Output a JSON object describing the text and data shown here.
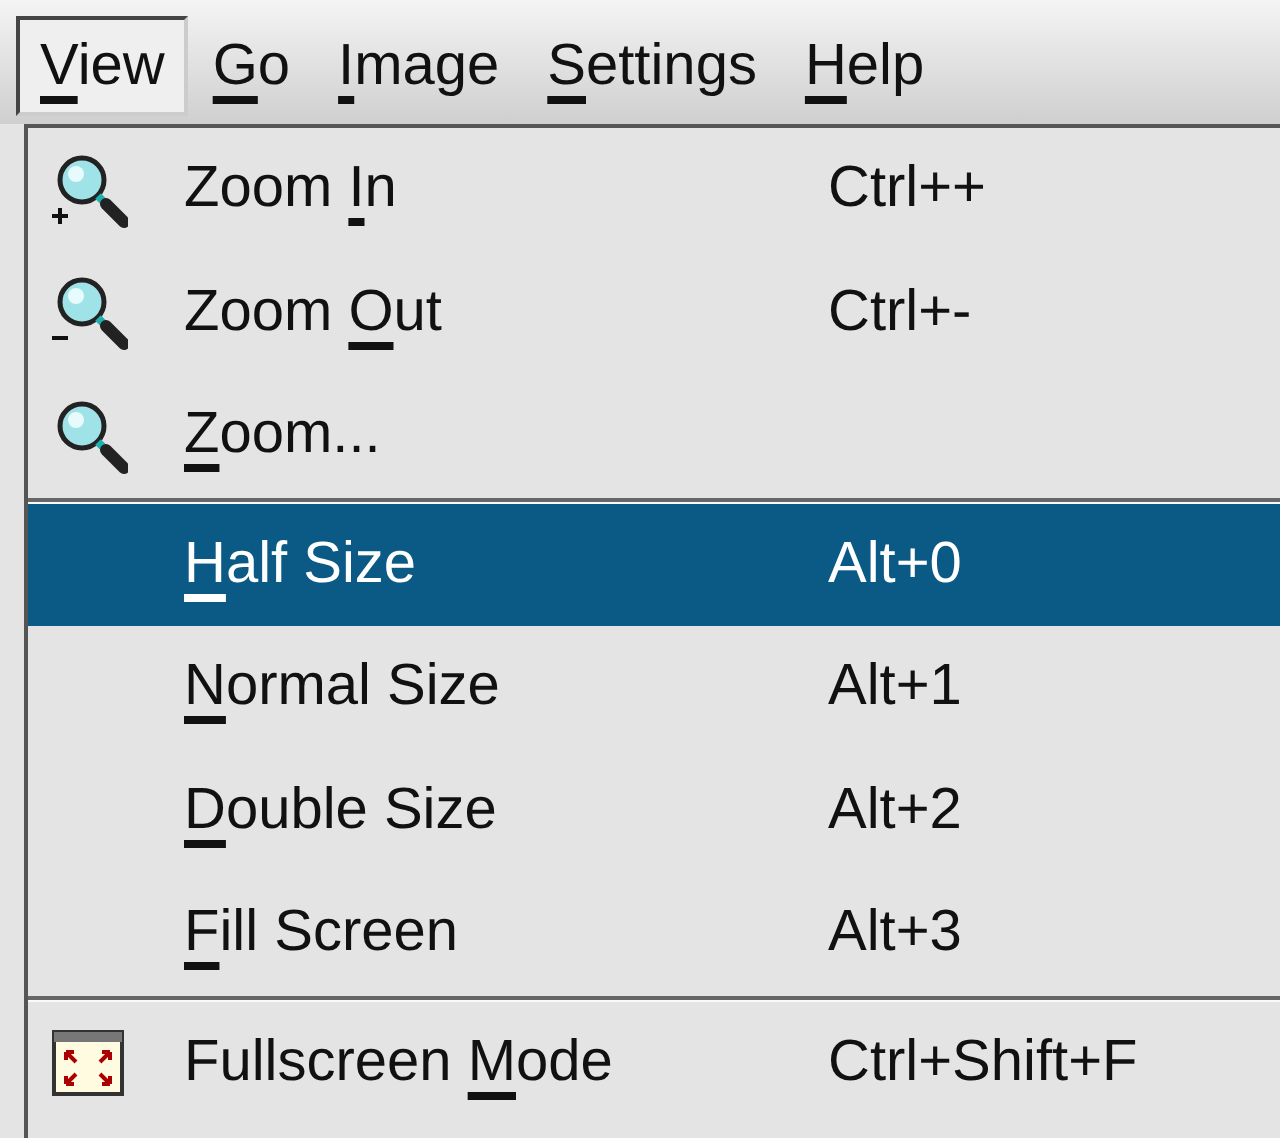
{
  "menubar": [
    {
      "label": [
        {
          "text": "V",
          "underlined": true
        },
        {
          "text": "iew",
          "underlined": false
        }
      ],
      "selected": true
    },
    {
      "label": [
        {
          "text": "G",
          "underlined": true
        },
        {
          "text": "o",
          "underlined": false
        }
      ],
      "selected": false
    },
    {
      "label": [
        {
          "text": "I",
          "underlined": true
        },
        {
          "text": "mage",
          "underlined": false
        }
      ],
      "selected": false
    },
    {
      "label": [
        {
          "text": "S",
          "underlined": true
        },
        {
          "text": "ettings",
          "underlined": false
        }
      ],
      "selected": false
    },
    {
      "label": [
        {
          "text": "H",
          "underlined": true
        },
        {
          "text": "elp",
          "underlined": false
        }
      ],
      "selected": false
    }
  ],
  "menu": [
    {
      "kind": "zoomin",
      "label": [
        {
          "text": "Zoom ",
          "underlined": false
        },
        {
          "text": "I",
          "underlined": true
        },
        {
          "text": "n",
          "underlined": false
        }
      ],
      "shortcut": "Ctrl++",
      "selected": false
    },
    {
      "kind": "zoomout",
      "label": [
        {
          "text": "Zoom ",
          "underlined": false
        },
        {
          "text": "O",
          "underlined": true
        },
        {
          "text": "ut",
          "underlined": false
        }
      ],
      "shortcut": "Ctrl+-",
      "selected": false
    },
    {
      "kind": "zoom",
      "label": [
        {
          "text": "Z",
          "underlined": true
        },
        {
          "text": "oom...",
          "underlined": false
        }
      ],
      "selected": false
    },
    {
      "kind": "separator"
    },
    {
      "kind": "plain",
      "label": [
        {
          "text": "H",
          "underlined": true
        },
        {
          "text": "alf Size",
          "underlined": false
        }
      ],
      "shortcut": "Alt+0",
      "selected": true
    },
    {
      "kind": "plain",
      "label": [
        {
          "text": "N",
          "underlined": true
        },
        {
          "text": "ormal Size",
          "underlined": false
        }
      ],
      "shortcut": "Alt+1",
      "selected": false
    },
    {
      "kind": "plain",
      "label": [
        {
          "text": "D",
          "underlined": true
        },
        {
          "text": "ouble Size",
          "underlined": false
        }
      ],
      "shortcut": "Alt+2",
      "selected": false
    },
    {
      "kind": "plain",
      "label": [
        {
          "text": "F",
          "underlined": true
        },
        {
          "text": "ill Screen",
          "underlined": false
        }
      ],
      "shortcut": "Alt+3",
      "selected": false
    },
    {
      "kind": "separator"
    },
    {
      "kind": "fullscreen",
      "label": [
        {
          "text": "Fullscreen ",
          "underlined": false
        },
        {
          "text": "M",
          "underlined": true
        },
        {
          "text": "ode",
          "underlined": false
        }
      ],
      "shortcut": "Ctrl+Shift+F",
      "selected": false
    }
  ]
}
